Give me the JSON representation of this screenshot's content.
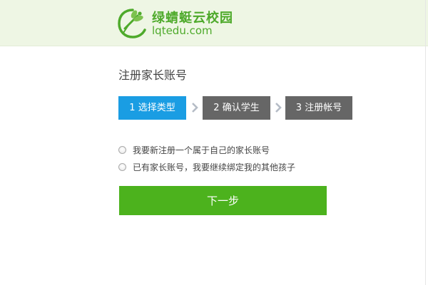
{
  "brand": {
    "name_cn": "绿蜻蜓云校园",
    "domain": "lqtedu.com",
    "logo_icon": "dragonfly-icon",
    "color": "#4eaa2b"
  },
  "page": {
    "title": "注册家长账号"
  },
  "steps": [
    {
      "label": "1 选择类型",
      "state": "active",
      "color": "#1a9de3"
    },
    {
      "label": "2 确认学生",
      "state": "inactive",
      "color": "#666666"
    },
    {
      "label": "3 注册帐号",
      "state": "inactive",
      "color": "#666666"
    }
  ],
  "options": [
    {
      "label": "我要新注册一个属于自己的家长账号",
      "checked": false
    },
    {
      "label": "已有家长账号，我要继续绑定我的其他孩子",
      "checked": false
    }
  ],
  "actions": {
    "next_label": "下一步",
    "next_color": "#4cb21d"
  },
  "colors": {
    "header_bg": "#eef6e4"
  }
}
